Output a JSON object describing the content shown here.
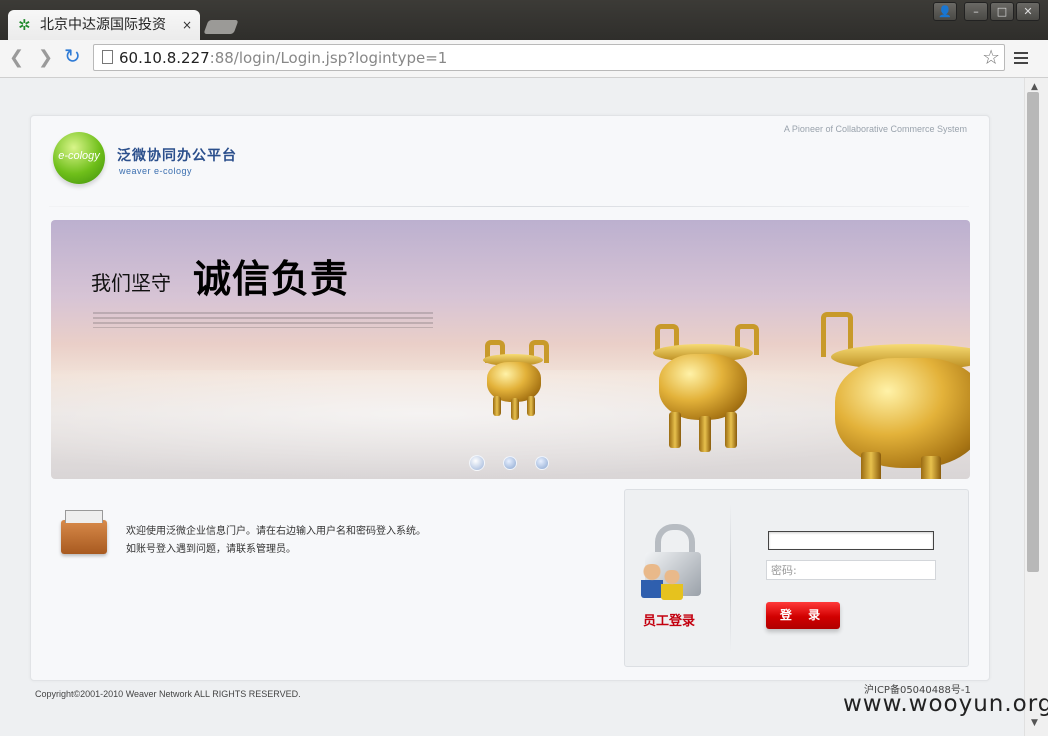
{
  "browser": {
    "tab_title": "北京中达源国际投资",
    "tab_close": "×",
    "url_host": "60.10.8.227",
    "url_rest": ":88/login/Login.jsp?logintype=1",
    "back_glyph": "❮",
    "forward_glyph": "❯",
    "reload_glyph": "↻",
    "star_glyph": "☆"
  },
  "window_controls": {
    "user": "👤",
    "minimize": "–",
    "maximize": "□",
    "close": "✕"
  },
  "header": {
    "tagline": "A Pioneer of Collaborative Commerce System",
    "logo_ball_text": "e-cology",
    "logo_cn": "泛微协同办公平台",
    "logo_en": "weaver e-cology"
  },
  "banner": {
    "slogan_small": "我们坚守",
    "slogan_big": "诚信负责",
    "slides_count": 3,
    "active_slide": 1
  },
  "welcome": {
    "line1": "欢迎使用泛微企业信息门户。请在右边输入用户名和密码登入系统。",
    "line2": "如账号登入遇到问题，请联系管理员。"
  },
  "login": {
    "title": "员工登录",
    "username_value": "",
    "password_placeholder": "密码:",
    "button_label": "登 录"
  },
  "footer": {
    "copyright": "Copyright©2001-2010 Weaver Network ALL RIGHTS RESERVED.",
    "icp": "沪ICP备05040488号-1"
  },
  "watermark": "www.wooyun.org",
  "colors": {
    "accent_red": "#c3000f",
    "logo_blue": "#2b4f8c",
    "logo_green": "#6fbf1a"
  }
}
